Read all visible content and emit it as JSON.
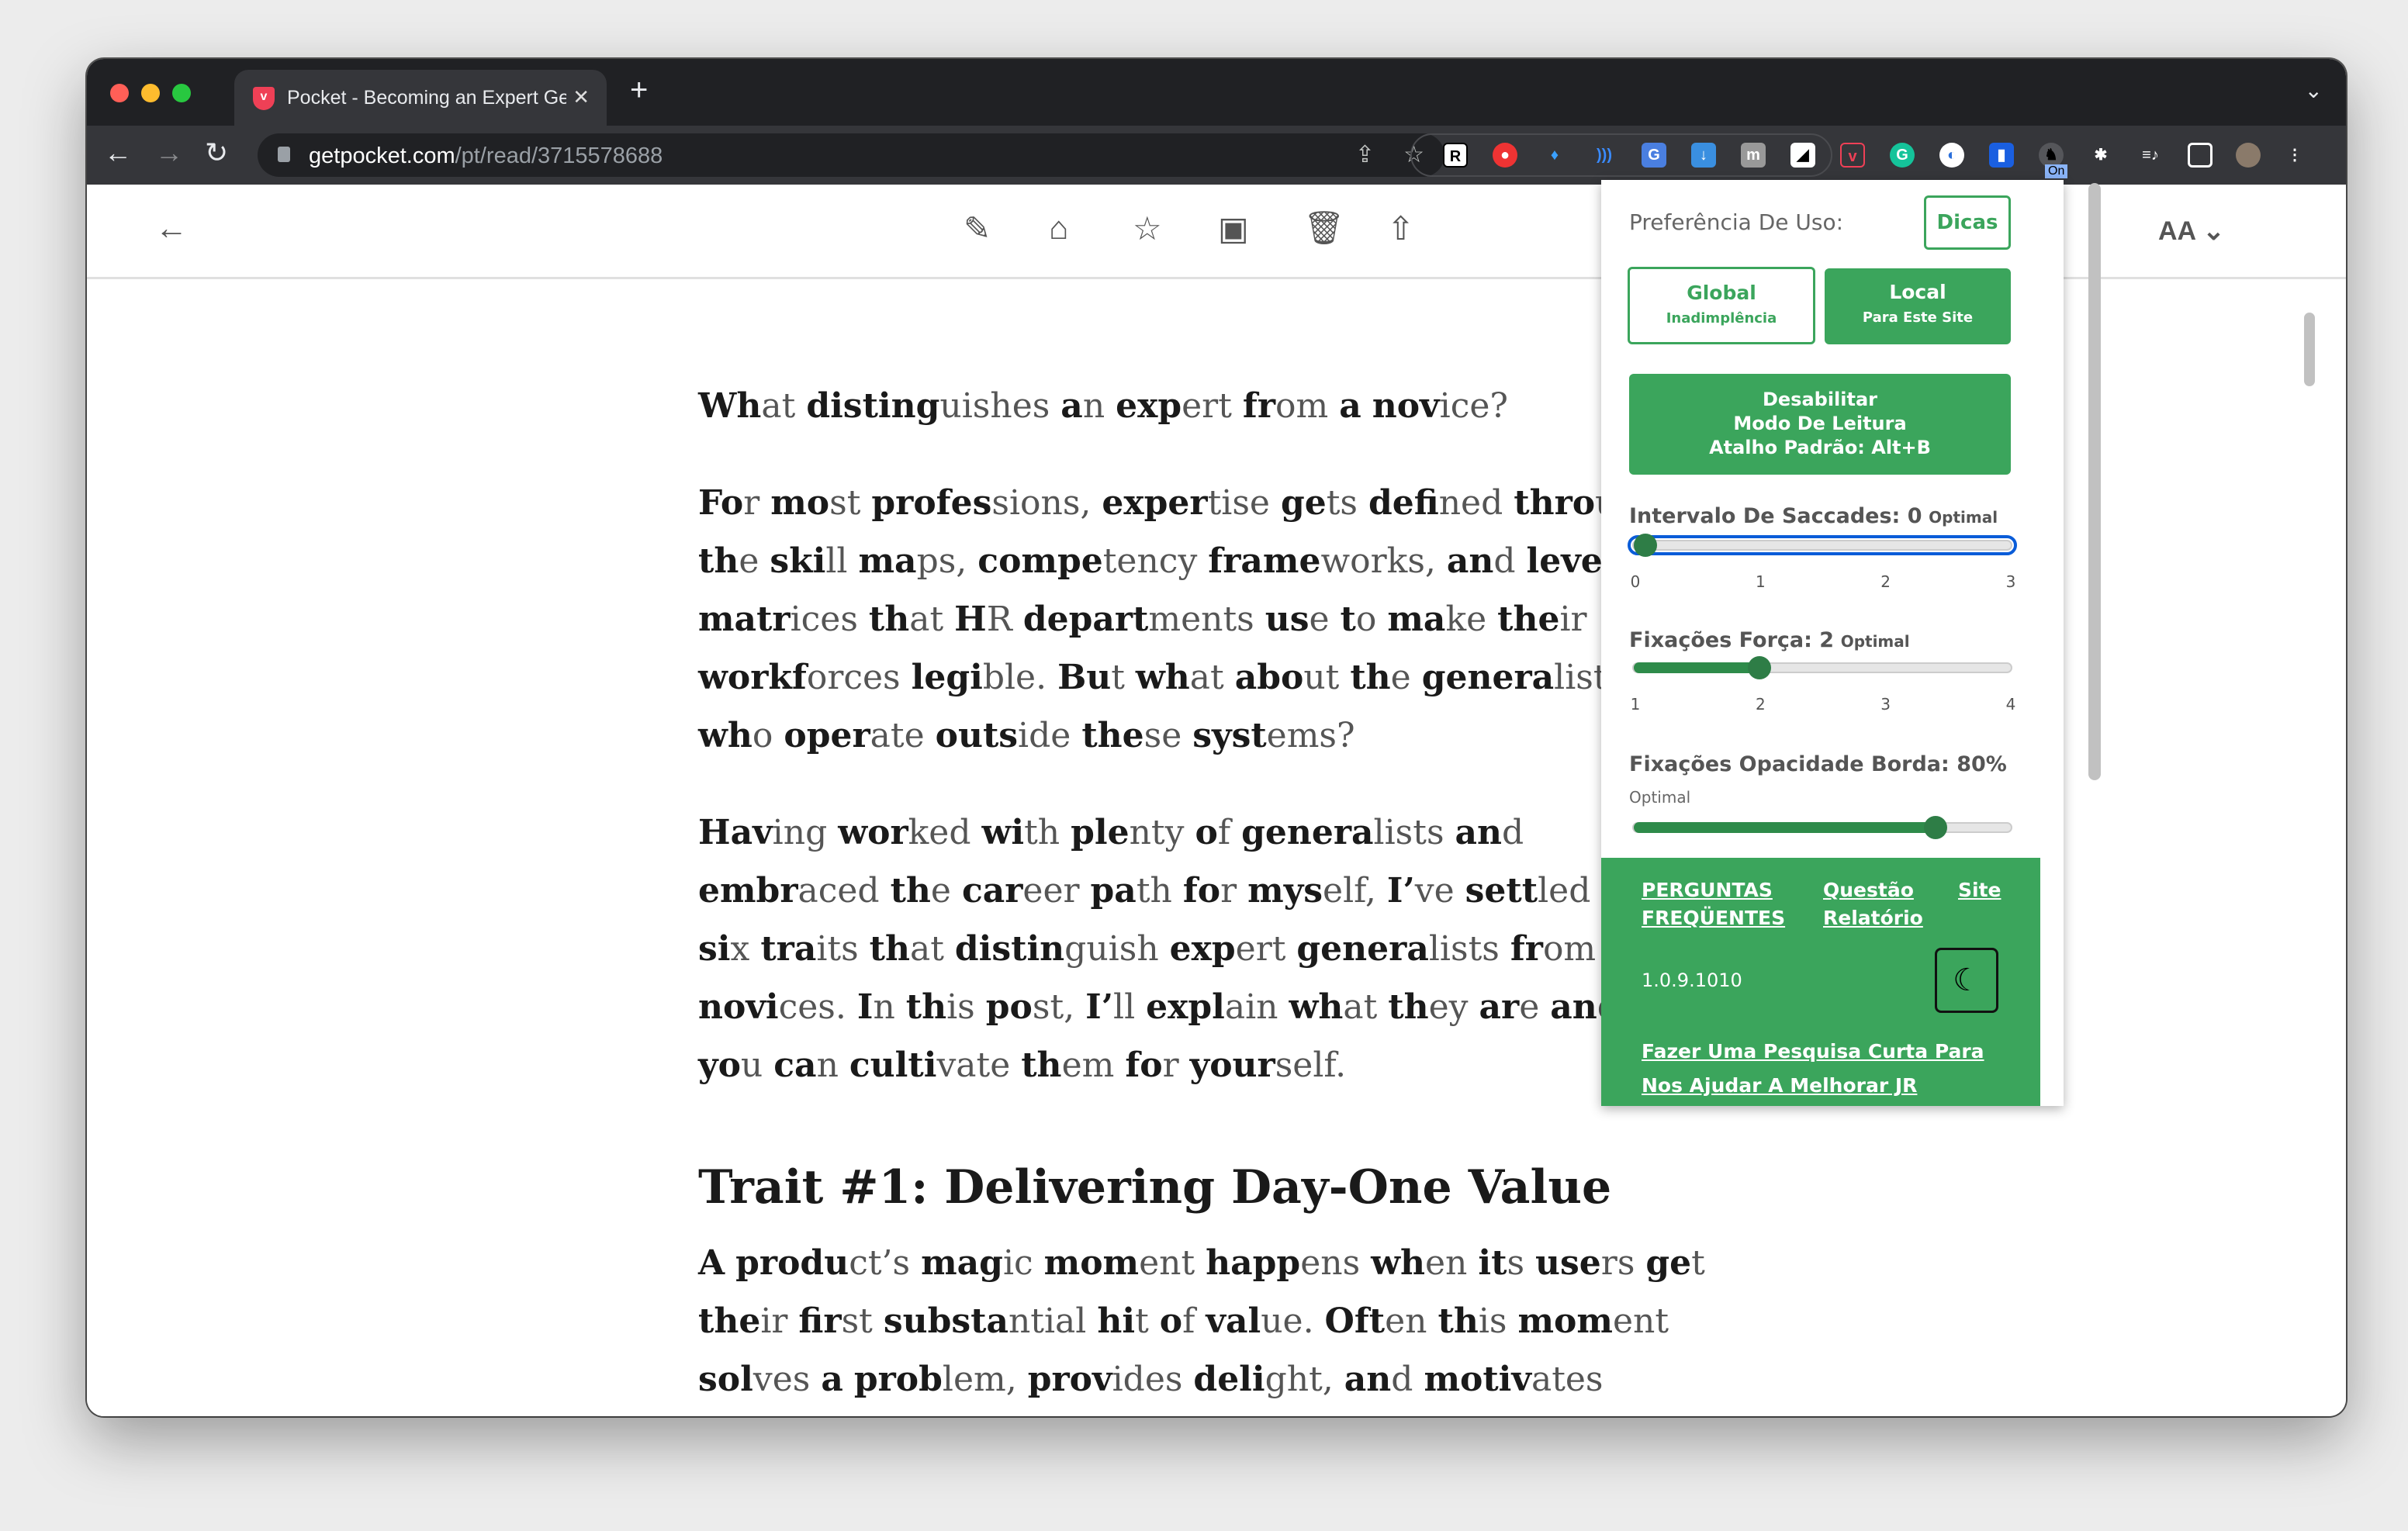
{
  "browser": {
    "tab_title": "Pocket - Becoming an Expert Generalist",
    "url_host": "getpocket.com",
    "url_path": "/pt/read/3715578688",
    "extension_badge": "On"
  },
  "reader": {
    "toolbar": [
      "back-icon",
      "highlight-icon",
      "tag-icon",
      "favorite-icon",
      "archive-icon",
      "delete-icon",
      "share-icon"
    ],
    "font_button": "AA"
  },
  "article": {
    "paragraphs": [
      "What distinguishes an expert from a novice?",
      "For most professions, expertise gets defined through the skill maps, competency frameworks, and leveling matrices that HR departments use to make their workforces legible. But what about the generalists who operate outside these systems?",
      "Having worked with plenty of generalists and embraced the career path for myself, I’ve settled on six traits that distinguish expert generalists from novices. In this post, I’ll explain what they are and how you can cultivate them for yourself."
    ],
    "heading": "Trait #1: Delivering Day-One Value",
    "paragraphs2": [
      "A product’s magic moment happens when its users get their first substantial hit of value. Often this moment solves a problem, provides delight, and motivates users to"
    ]
  },
  "popup": {
    "pref_title": "Preferência De Uso:",
    "tips": "Dicas",
    "global": "Global",
    "global_sub": "Inadimplência",
    "local": "Local",
    "local_sub": "Para Este Site",
    "disable": [
      "Desabilitar",
      "Modo De Leitura",
      "Atalho Padrão: Alt+B"
    ],
    "sliders": [
      {
        "label": "Intervalo De Saccades: 0",
        "hint": "Optimal",
        "min": 0,
        "max": 3,
        "value": 0,
        "ticks": [
          "0",
          "1",
          "2",
          "3"
        ]
      },
      {
        "label": "Fixações Força: 2",
        "hint": "Optimal",
        "min": 1,
        "max": 4,
        "value": 2,
        "ticks": [
          "1",
          "2",
          "3",
          "4"
        ]
      },
      {
        "label": "Fixações Opacidade Borda: 80%",
        "hint": "Optimal",
        "min": 0,
        "max": 100,
        "value": 80
      }
    ],
    "faq": "PERGUNTAS FREQÜENTES",
    "report": "Questão Relatório",
    "site": "Site",
    "version": "1.0.9.1010",
    "survey": "Fazer Uma Pesquisa Curta Para Nos Ajudar A Melhorar JR"
  },
  "colors": {
    "accent": "#3ba55c",
    "slider": "#2e7d46",
    "tab_bar": "#202124"
  }
}
